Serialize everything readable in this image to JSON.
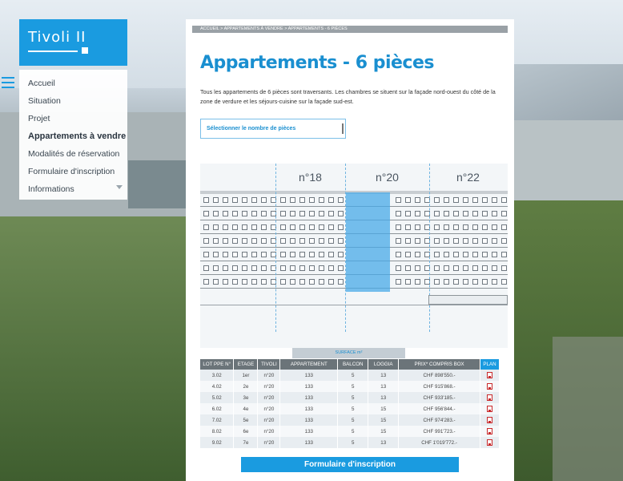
{
  "logo": {
    "text": "Tivoli II"
  },
  "menu": {
    "items": [
      {
        "label": "Accueil",
        "active": false
      },
      {
        "label": "Situation",
        "active": false
      },
      {
        "label": "Projet",
        "active": false
      },
      {
        "label": "Appartements à vendre",
        "active": true
      },
      {
        "label": "Modalités de réservation",
        "active": false
      },
      {
        "label": "Formulaire d'inscription",
        "active": false
      },
      {
        "label": "Informations",
        "active": false
      }
    ]
  },
  "breadcrumb": "ACCUEIL > APPARTEMENTS À VENDRE > APPARTEMENTS - 6 PIÈCES",
  "page": {
    "title": "Appartements - 6 pièces",
    "intro": "Tous les appartements de 6 pièces sont traversants. Les chambres se situent sur la façade nord-ouest du côté de la zone de verdure et les séjours-cuisine sur la façade sud-est.",
    "select_label": "Sélectionner le nombre de pièces"
  },
  "building": {
    "numbers": [
      "n°18",
      "n°20",
      "n°22"
    ],
    "highlight_color": "#48aae8"
  },
  "table": {
    "surface_label": "SURFACE m²",
    "headers": [
      "LOT PPE N°",
      "ETAGE",
      "TIVOLI",
      "APPARTEMENT",
      "BALCON",
      "LOGGIA",
      "PRIX* COMPRIS BOX",
      "PLAN"
    ],
    "rows": [
      [
        "3.02",
        "1er",
        "n°20",
        "133",
        "5",
        "13",
        "CHF 898'550.-"
      ],
      [
        "4.02",
        "2e",
        "n°20",
        "133",
        "5",
        "13",
        "CHF 915'868.-"
      ],
      [
        "5.02",
        "3e",
        "n°20",
        "133",
        "5",
        "13",
        "CHF 933'185.-"
      ],
      [
        "6.02",
        "4e",
        "n°20",
        "133",
        "5",
        "15",
        "CHF 956'844.-"
      ],
      [
        "7.02",
        "5e",
        "n°20",
        "133",
        "5",
        "15",
        "CHF 974'283.-"
      ],
      [
        "8.02",
        "6e",
        "n°20",
        "133",
        "5",
        "15",
        "CHF 991'723.-"
      ],
      [
        "9.02",
        "7e",
        "n°20",
        "133",
        "5",
        "13",
        "CHF 1'019'772.-"
      ]
    ]
  },
  "cta_label": "Formulaire d'inscription",
  "colors": {
    "accent": "#1a9be0",
    "header_gray": "#6b7479"
  }
}
